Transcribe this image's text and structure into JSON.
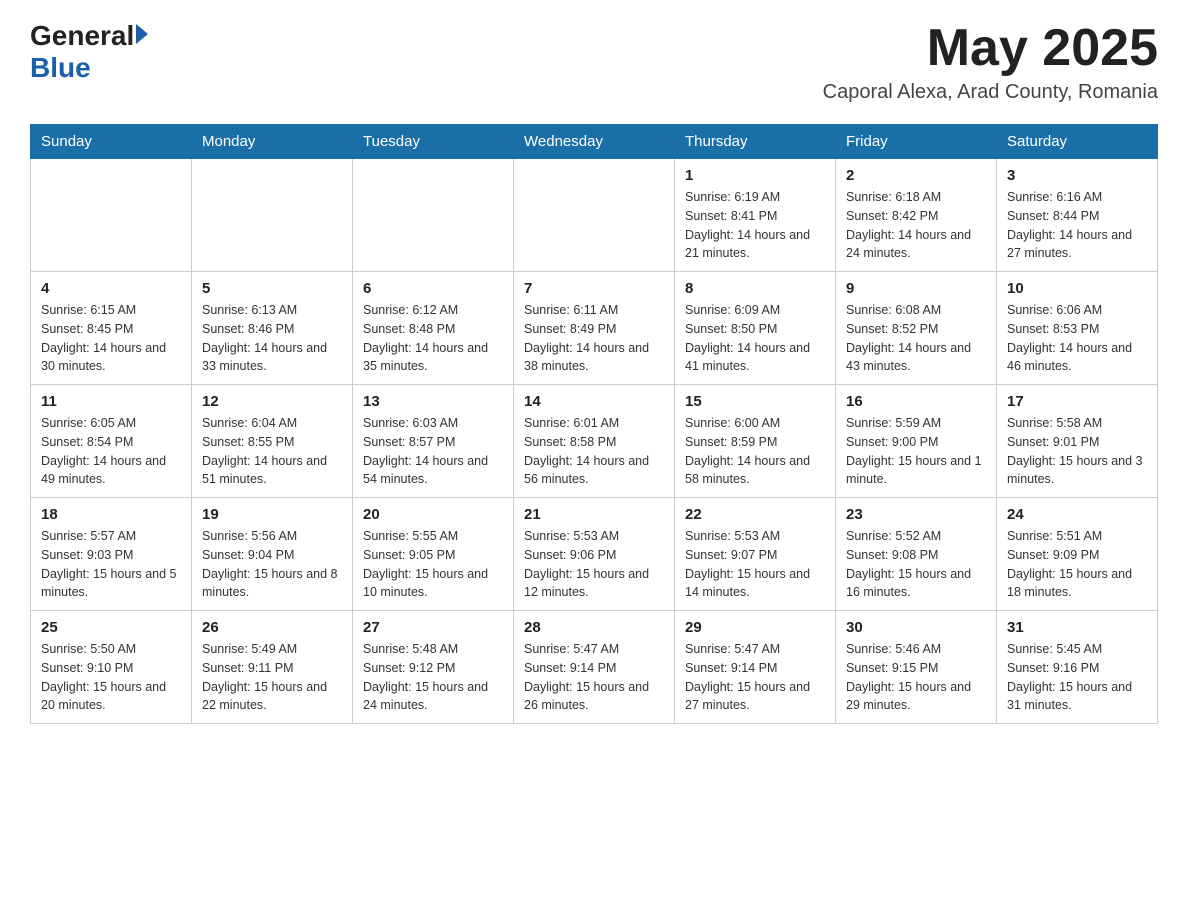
{
  "header": {
    "logo_general": "General",
    "logo_blue": "Blue",
    "month_title": "May 2025",
    "location": "Caporal Alexa, Arad County, Romania"
  },
  "weekdays": [
    "Sunday",
    "Monday",
    "Tuesday",
    "Wednesday",
    "Thursday",
    "Friday",
    "Saturday"
  ],
  "weeks": [
    [
      {
        "day": "",
        "detail": ""
      },
      {
        "day": "",
        "detail": ""
      },
      {
        "day": "",
        "detail": ""
      },
      {
        "day": "",
        "detail": ""
      },
      {
        "day": "1",
        "detail": "Sunrise: 6:19 AM\nSunset: 8:41 PM\nDaylight: 14 hours and 21 minutes."
      },
      {
        "day": "2",
        "detail": "Sunrise: 6:18 AM\nSunset: 8:42 PM\nDaylight: 14 hours and 24 minutes."
      },
      {
        "day": "3",
        "detail": "Sunrise: 6:16 AM\nSunset: 8:44 PM\nDaylight: 14 hours and 27 minutes."
      }
    ],
    [
      {
        "day": "4",
        "detail": "Sunrise: 6:15 AM\nSunset: 8:45 PM\nDaylight: 14 hours and 30 minutes."
      },
      {
        "day": "5",
        "detail": "Sunrise: 6:13 AM\nSunset: 8:46 PM\nDaylight: 14 hours and 33 minutes."
      },
      {
        "day": "6",
        "detail": "Sunrise: 6:12 AM\nSunset: 8:48 PM\nDaylight: 14 hours and 35 minutes."
      },
      {
        "day": "7",
        "detail": "Sunrise: 6:11 AM\nSunset: 8:49 PM\nDaylight: 14 hours and 38 minutes."
      },
      {
        "day": "8",
        "detail": "Sunrise: 6:09 AM\nSunset: 8:50 PM\nDaylight: 14 hours and 41 minutes."
      },
      {
        "day": "9",
        "detail": "Sunrise: 6:08 AM\nSunset: 8:52 PM\nDaylight: 14 hours and 43 minutes."
      },
      {
        "day": "10",
        "detail": "Sunrise: 6:06 AM\nSunset: 8:53 PM\nDaylight: 14 hours and 46 minutes."
      }
    ],
    [
      {
        "day": "11",
        "detail": "Sunrise: 6:05 AM\nSunset: 8:54 PM\nDaylight: 14 hours and 49 minutes."
      },
      {
        "day": "12",
        "detail": "Sunrise: 6:04 AM\nSunset: 8:55 PM\nDaylight: 14 hours and 51 minutes."
      },
      {
        "day": "13",
        "detail": "Sunrise: 6:03 AM\nSunset: 8:57 PM\nDaylight: 14 hours and 54 minutes."
      },
      {
        "day": "14",
        "detail": "Sunrise: 6:01 AM\nSunset: 8:58 PM\nDaylight: 14 hours and 56 minutes."
      },
      {
        "day": "15",
        "detail": "Sunrise: 6:00 AM\nSunset: 8:59 PM\nDaylight: 14 hours and 58 minutes."
      },
      {
        "day": "16",
        "detail": "Sunrise: 5:59 AM\nSunset: 9:00 PM\nDaylight: 15 hours and 1 minute."
      },
      {
        "day": "17",
        "detail": "Sunrise: 5:58 AM\nSunset: 9:01 PM\nDaylight: 15 hours and 3 minutes."
      }
    ],
    [
      {
        "day": "18",
        "detail": "Sunrise: 5:57 AM\nSunset: 9:03 PM\nDaylight: 15 hours and 5 minutes."
      },
      {
        "day": "19",
        "detail": "Sunrise: 5:56 AM\nSunset: 9:04 PM\nDaylight: 15 hours and 8 minutes."
      },
      {
        "day": "20",
        "detail": "Sunrise: 5:55 AM\nSunset: 9:05 PM\nDaylight: 15 hours and 10 minutes."
      },
      {
        "day": "21",
        "detail": "Sunrise: 5:53 AM\nSunset: 9:06 PM\nDaylight: 15 hours and 12 minutes."
      },
      {
        "day": "22",
        "detail": "Sunrise: 5:53 AM\nSunset: 9:07 PM\nDaylight: 15 hours and 14 minutes."
      },
      {
        "day": "23",
        "detail": "Sunrise: 5:52 AM\nSunset: 9:08 PM\nDaylight: 15 hours and 16 minutes."
      },
      {
        "day": "24",
        "detail": "Sunrise: 5:51 AM\nSunset: 9:09 PM\nDaylight: 15 hours and 18 minutes."
      }
    ],
    [
      {
        "day": "25",
        "detail": "Sunrise: 5:50 AM\nSunset: 9:10 PM\nDaylight: 15 hours and 20 minutes."
      },
      {
        "day": "26",
        "detail": "Sunrise: 5:49 AM\nSunset: 9:11 PM\nDaylight: 15 hours and 22 minutes."
      },
      {
        "day": "27",
        "detail": "Sunrise: 5:48 AM\nSunset: 9:12 PM\nDaylight: 15 hours and 24 minutes."
      },
      {
        "day": "28",
        "detail": "Sunrise: 5:47 AM\nSunset: 9:14 PM\nDaylight: 15 hours and 26 minutes."
      },
      {
        "day": "29",
        "detail": "Sunrise: 5:47 AM\nSunset: 9:14 PM\nDaylight: 15 hours and 27 minutes."
      },
      {
        "day": "30",
        "detail": "Sunrise: 5:46 AM\nSunset: 9:15 PM\nDaylight: 15 hours and 29 minutes."
      },
      {
        "day": "31",
        "detail": "Sunrise: 5:45 AM\nSunset: 9:16 PM\nDaylight: 15 hours and 31 minutes."
      }
    ]
  ]
}
